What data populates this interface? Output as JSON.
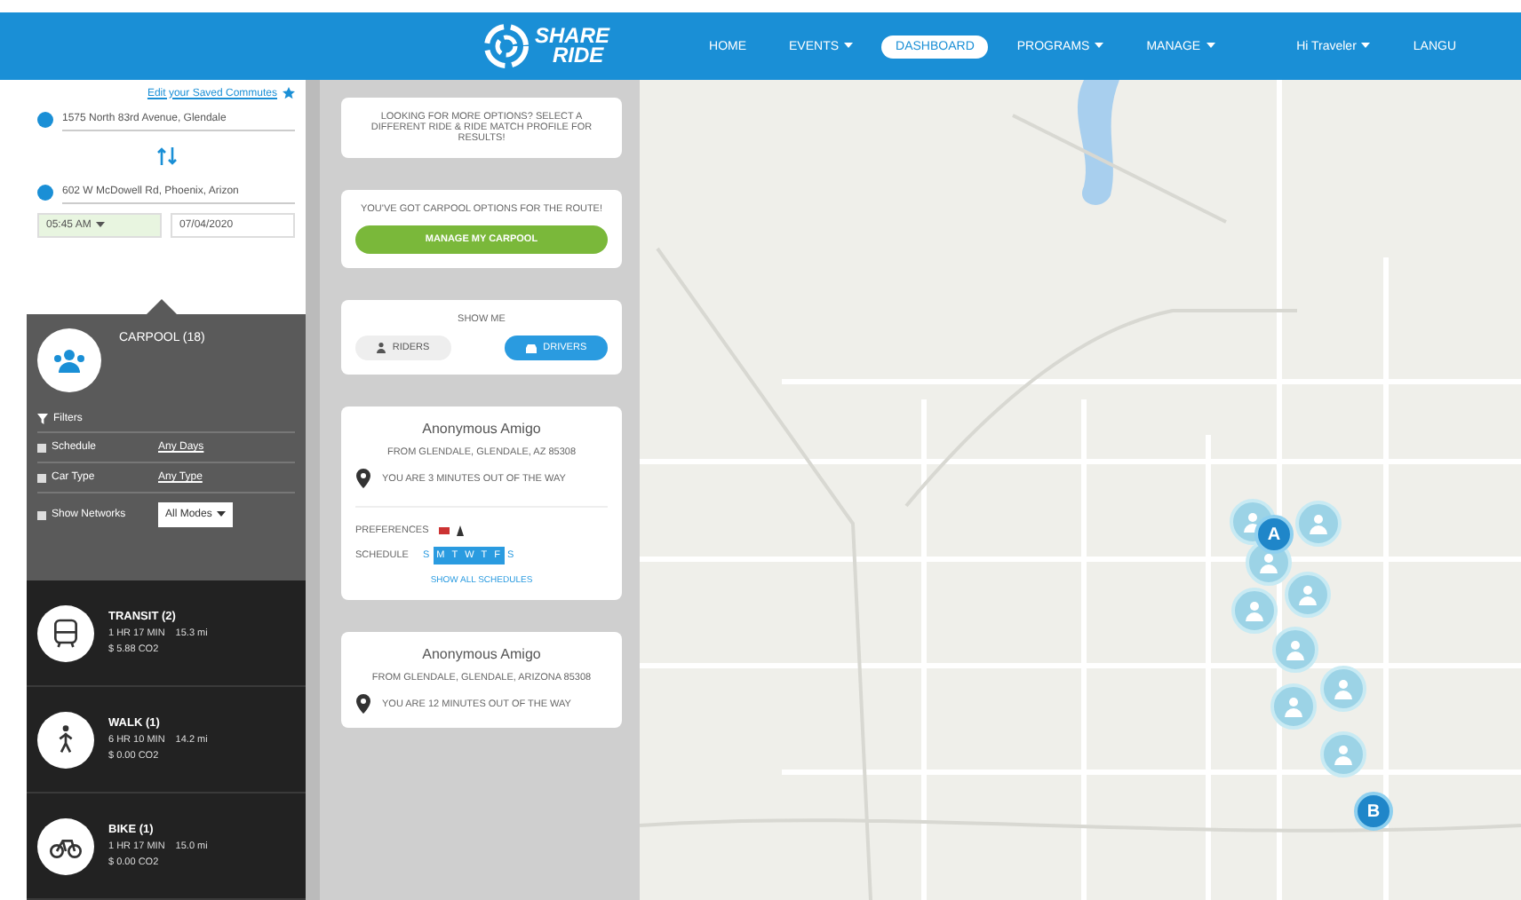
{
  "header": {
    "logo_top": "SHARE",
    "logo_bottom": "RIDE",
    "nav": [
      {
        "label": "HOME",
        "dropdown": false,
        "selected": false
      },
      {
        "label": "EVENTS",
        "dropdown": true,
        "selected": false
      },
      {
        "label": "DASHBOARD",
        "dropdown": false,
        "selected": true
      },
      {
        "label": "PROGRAMS",
        "dropdown": true,
        "selected": false
      },
      {
        "label": "MANAGE",
        "dropdown": true,
        "selected": false
      },
      {
        "label": "Hi Traveler",
        "dropdown": true,
        "selected": false
      },
      {
        "label": "LANGU",
        "dropdown": false,
        "selected": false
      }
    ]
  },
  "trip": {
    "saved_link": "Edit your Saved Commutes",
    "origin": "1575 North 83rd Avenue, Glendale",
    "destination": "602 W McDowell Rd, Phoenix, Arizon",
    "time": "05:45 AM",
    "date": "07/04/2020"
  },
  "carpool": {
    "title": "CARPOOL (18)",
    "filters_label": "Filters",
    "filters": [
      {
        "kind": "text",
        "label": "Schedule",
        "value": "Any Days"
      },
      {
        "kind": "text",
        "label": "Car Type",
        "value": "Any Type"
      },
      {
        "kind": "select",
        "label": "Show Networks",
        "value": "All Modes"
      }
    ]
  },
  "modes": [
    {
      "kind": "transit",
      "title": "TRANSIT (2)",
      "duration": "1 HR 17 MIN",
      "distance": "15.3 mi",
      "cost": "$ 5.88 CO2"
    },
    {
      "kind": "walk",
      "title": "WALK (1)",
      "duration": "6 HR 10 MIN",
      "distance": "14.2 mi",
      "cost": "$ 0.00 CO2"
    },
    {
      "kind": "bike",
      "title": "BIKE (1)",
      "duration": "1 HR 17 MIN",
      "distance": "15.0 mi",
      "cost": "$ 0.00 CO2"
    }
  ],
  "results": {
    "info_card": "LOOKING FOR MORE OPTIONS? SELECT A DIFFERENT RIDE & RIDE MATCH PROFILE FOR RESULTS!",
    "carpool_card": {
      "text": "YOU'VE GOT CARPOOL OPTIONS FOR THE ROUTE!",
      "button": "MANAGE MY CARPOOL"
    },
    "show_me": {
      "title": "SHOW ME",
      "options": [
        {
          "kind": "rider",
          "label": "RIDERS",
          "selected": false
        },
        {
          "kind": "driver",
          "label": "DRIVERS",
          "selected": true
        }
      ]
    },
    "matches": [
      {
        "name": "Anonymous Amigo",
        "from": "FROM GLENDALE, GLENDALE, AZ 85308",
        "detour": "YOU ARE 3 MINUTES OUT OF THE WAY",
        "preferences_label": "PREFERENCES",
        "schedule_label": "SCHEDULE",
        "days": [
          {
            "label": "S",
            "selected": false
          },
          {
            "label": "M",
            "selected": true
          },
          {
            "label": "T",
            "selected": true
          },
          {
            "label": "W",
            "selected": true
          },
          {
            "label": "T",
            "selected": true
          },
          {
            "label": "F",
            "selected": true
          },
          {
            "label": "S",
            "selected": false
          }
        ],
        "schedule_link": "SHOW ALL SCHEDULES"
      },
      {
        "name": "Anonymous Amigo",
        "from": "FROM GLENDALE, GLENDALE, ARIZONA 85308",
        "detour": "YOU ARE 12 MINUTES OUT OF THE WAY"
      }
    ]
  },
  "map": {
    "start_marker": "A",
    "end_marker": "B"
  }
}
